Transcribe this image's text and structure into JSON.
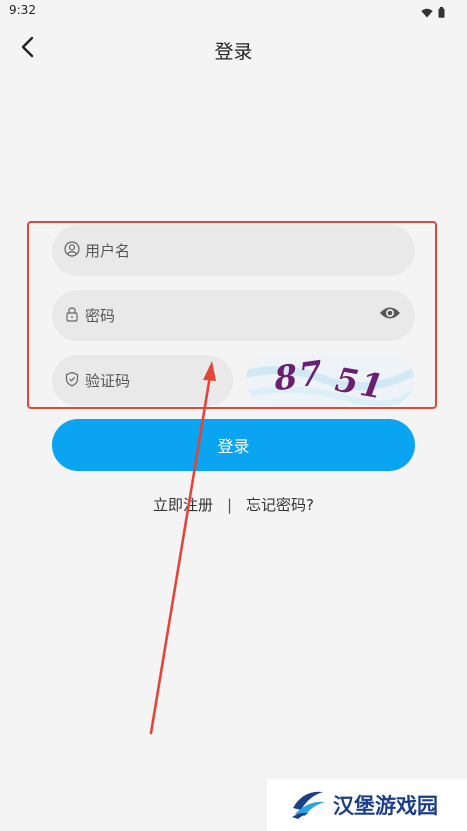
{
  "status_bar": {
    "time": "9:32",
    "icons": [
      "wifi-icon",
      "battery-icon"
    ]
  },
  "header": {
    "title": "登录",
    "back_icon": "chevron-left-icon"
  },
  "form": {
    "username": {
      "placeholder": "用户名",
      "icon": "user-icon"
    },
    "password": {
      "placeholder": "密码",
      "icon": "lock-icon",
      "toggle_icon": "eye-icon"
    },
    "captcha": {
      "placeholder": "验证码",
      "icon": "shield-icon",
      "image_text": [
        "87",
        "51"
      ]
    }
  },
  "login_button": {
    "label": "登录"
  },
  "links": {
    "register": "立即注册",
    "separator": "|",
    "forgot": "忘记密码?"
  },
  "watermark": {
    "text": "汉堡游戏园"
  },
  "colors": {
    "primary": "#0aa4f0",
    "annotation": "#e2463a",
    "captcha_text": "#6a1f73",
    "watermark": "#1d3f8a"
  }
}
